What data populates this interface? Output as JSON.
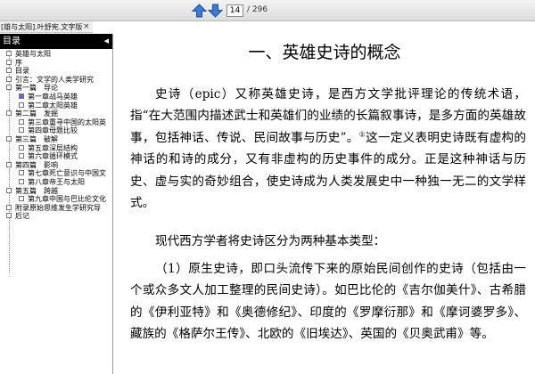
{
  "toolbar": {
    "page_current": "14",
    "page_total": "/ 296"
  },
  "document_tab": {
    "title": "[雄与太阳].叶舒宪.文字版",
    "close": "×"
  },
  "sidebar": {
    "header": "目录",
    "items": [
      {
        "label": "英雄与太阳",
        "level": 0
      },
      {
        "label": "序",
        "level": 0
      },
      {
        "label": "目录",
        "level": 0
      },
      {
        "label": "引言：文学的人类学研究",
        "level": 0
      },
      {
        "label": "第一篇　导论",
        "level": 0
      },
      {
        "label": "第一章战马英雄",
        "level": 1
      },
      {
        "label": "第二章太阳英雄",
        "level": 1
      },
      {
        "label": "第二篇　发掘",
        "level": 0
      },
      {
        "label": "第三章重寻中国的太阳英",
        "level": 1
      },
      {
        "label": "第四章母题比较",
        "level": 1
      },
      {
        "label": "第三篇　破解",
        "level": 0
      },
      {
        "label": "第五章深层结构",
        "level": 1
      },
      {
        "label": "第六章循环模式",
        "level": 1
      },
      {
        "label": "第四篇　影响",
        "level": 0
      },
      {
        "label": "第七章死亡意识与中国文",
        "level": 1
      },
      {
        "label": "第八章帝王与太阳",
        "level": 1
      },
      {
        "label": "第五篇　跨越",
        "level": 0
      },
      {
        "label": "第九章中国与巴比伦文化",
        "level": 1
      },
      {
        "label": "附录原始思维发生学研究导",
        "level": 0
      },
      {
        "label": "后记",
        "level": 0
      }
    ]
  },
  "content": {
    "heading": "一、英雄史诗的概念",
    "para1": "史诗（epic）又称英雄史诗，是西方文学批评理论的传统术语，指“在大范围内描述武士和英雄们的业绩的长篇叙事诗，是多方面的英雄故事，包括神话、传说、民间故事与历史”。",
    "para1_note": "①",
    "para1_cont": "这一定义表明史诗既有虚构的神话的和诗的成分，又有非虚构的历史事件的成分。正是这种神话与历史、虚与实的奇妙组合，使史诗成为人类发展史中一种独一无二的文学样式。",
    "para2": "现代西方学者将史诗区分为两种基本类型：",
    "para3": "（1）原生史诗，即口头流传下来的原始民间创作的史诗（包括由一个或众多文人加工整理的民间史诗）。如巴比伦的《吉尔伽美什》、古希腊的《伊利亚特》和《奥德修纪》、印度的《罗摩衍那》和《摩诃婆罗多》、藏族的《格萨尔王传》、北欧的《旧埃达》、英国的《贝奥武甫》等。"
  }
}
